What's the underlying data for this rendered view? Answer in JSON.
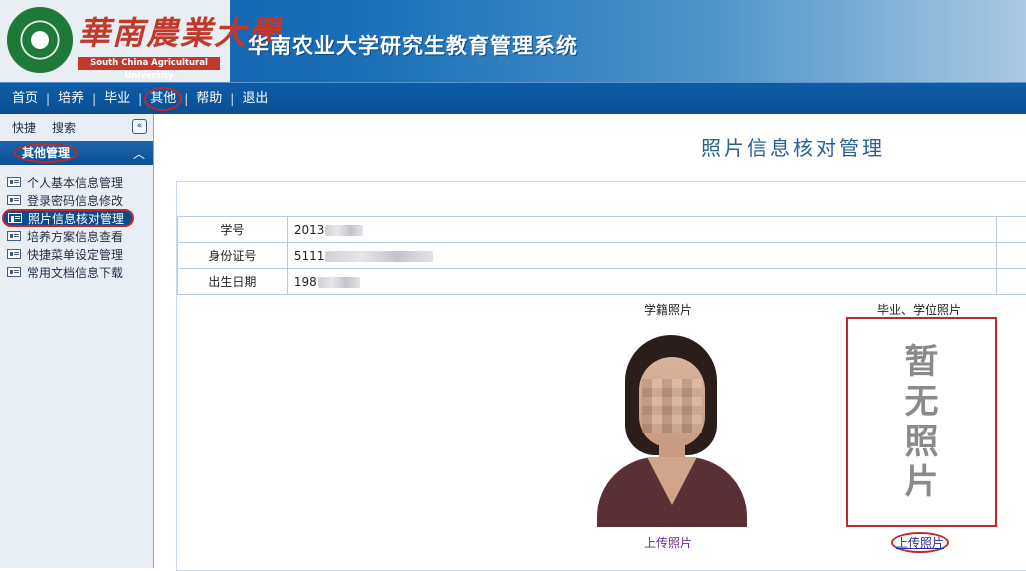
{
  "header": {
    "logo_cn": "華南農業大學",
    "logo_en": "South China Agricultural University",
    "system_title": "华南农业大学研究生教育管理系统"
  },
  "topnav": {
    "items": [
      {
        "label": "首页"
      },
      {
        "label": "培养"
      },
      {
        "label": "毕业"
      },
      {
        "label": "其他"
      },
      {
        "label": "帮助"
      },
      {
        "label": "退出"
      }
    ],
    "active": "其他"
  },
  "sidebar": {
    "quick_links": [
      "快捷",
      "搜索"
    ],
    "collapse_icon": "double-chevron-left-icon",
    "group_title": "其他管理",
    "items": [
      {
        "label": "个人基本信息管理"
      },
      {
        "label": "登录密码信息修改"
      },
      {
        "label": "照片信息核对管理",
        "active": true
      },
      {
        "label": "培养方案信息查看"
      },
      {
        "label": "快捷菜单设定管理"
      },
      {
        "label": "常用文档信息下载"
      }
    ]
  },
  "main": {
    "page_title": "照片信息核对管理",
    "info": [
      {
        "label": "学号",
        "value": "2013"
      },
      {
        "label": "身份证号",
        "value": "5111"
      },
      {
        "label": "出生日期",
        "value": "198"
      }
    ],
    "school_photo": {
      "label": "学籍照片",
      "upload_label": "上传照片"
    },
    "degree_photo": {
      "label": "毕业、学位照片",
      "placeholder_chars": [
        "暂",
        "无",
        "照",
        "片"
      ],
      "upload_label": "上传照片"
    }
  },
  "colors": {
    "nav_blue": "#0d5ca8",
    "highlight_red": "#c1272d",
    "title_blue": "#2a5f94"
  }
}
